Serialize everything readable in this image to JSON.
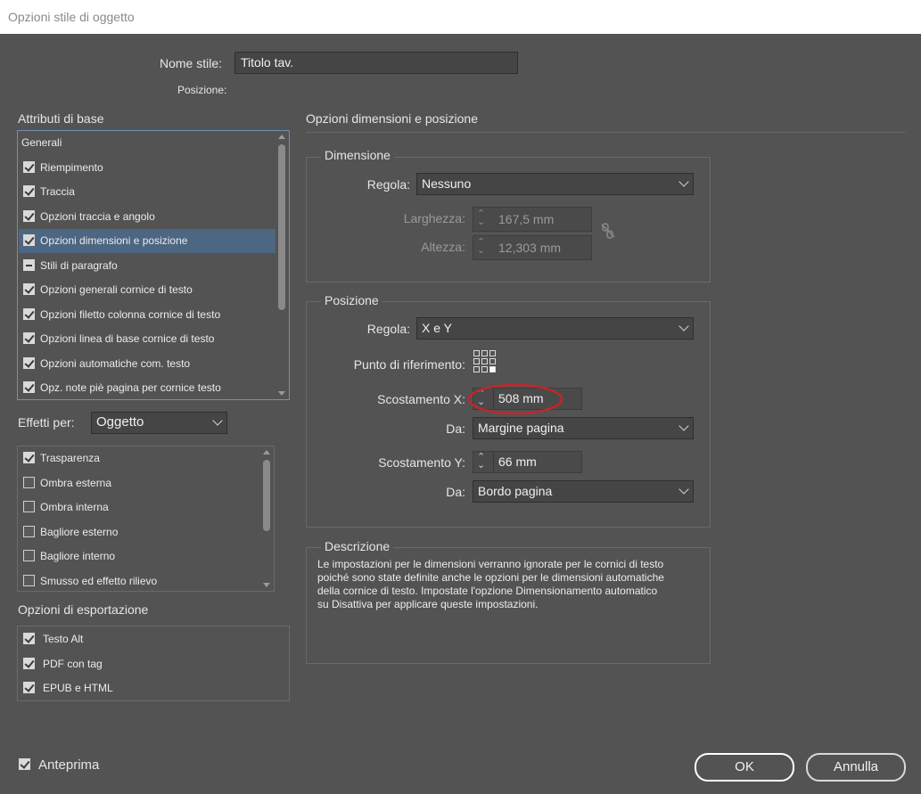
{
  "window": {
    "title": "Opzioni stile di oggetto"
  },
  "header": {
    "style_name_label": "Nome stile:",
    "style_name_value": "Titolo tav.",
    "position_label": "Posizione:"
  },
  "basic_attributes": {
    "heading": "Attributi di base",
    "items": [
      {
        "label": "Generali",
        "state": "none"
      },
      {
        "label": "Riempimento",
        "state": "checked"
      },
      {
        "label": "Traccia",
        "state": "checked"
      },
      {
        "label": "Opzioni traccia e angolo",
        "state": "checked"
      },
      {
        "label": "Opzioni dimensioni e posizione",
        "state": "checked"
      },
      {
        "label": "Stili di paragrafo",
        "state": "mixed"
      },
      {
        "label": "Opzioni generali cornice di testo",
        "state": "checked"
      },
      {
        "label": "Opzioni filetto colonna cornice di testo",
        "state": "checked"
      },
      {
        "label": "Opzioni linea di base cornice di testo",
        "state": "checked"
      },
      {
        "label": "Opzioni automatiche com. testo",
        "state": "checked"
      },
      {
        "label": "Opz. note piè pagina per cornice testo",
        "state": "checked"
      }
    ],
    "selected_index": 4
  },
  "effects": {
    "label": "Effetti per:",
    "value": "Oggetto",
    "items": [
      {
        "label": "Trasparenza",
        "checked": true
      },
      {
        "label": "Ombra esterna",
        "checked": false
      },
      {
        "label": "Ombra interna",
        "checked": false
      },
      {
        "label": "Bagliore esterno",
        "checked": false
      },
      {
        "label": "Bagliore interno",
        "checked": false
      },
      {
        "label": "Smusso ed effetto rilievo",
        "checked": false
      }
    ]
  },
  "export": {
    "heading": "Opzioni di esportazione",
    "items": [
      {
        "label": "Testo Alt",
        "checked": true
      },
      {
        "label": "PDF con tag",
        "checked": true
      },
      {
        "label": "EPUB e HTML",
        "checked": true
      }
    ]
  },
  "panel": {
    "title": "Opzioni dimensioni e posizione",
    "size": {
      "legend": "Dimensione",
      "rule_label": "Regola:",
      "rule_value": "Nessuno",
      "width_label": "Larghezza:",
      "width_value": "167,5 mm",
      "height_label": "Altezza:",
      "height_value": "12,303 mm"
    },
    "position": {
      "legend": "Posizione",
      "rule_label": "Regola:",
      "rule_value": "X e Y",
      "ref_point_label": "Punto di riferimento:",
      "offset_x_label": "Scostamento X:",
      "offset_x_value": "508 mm",
      "from_x_label": "Da:",
      "from_x_value": "Margine pagina",
      "offset_y_label": "Scostamento Y:",
      "offset_y_value": "66 mm",
      "from_y_label": "Da:",
      "from_y_value": "Bordo pagina"
    },
    "description": {
      "legend": "Descrizione",
      "lines": [
        "Le impostazioni per le dimensioni verranno ignorate per le cornici di testo",
        "poiché sono state definite anche le opzioni per le dimensioni automatiche",
        "della cornice di testo. Impostate l'opzione Dimensionamento automatico",
        "su Disattiva per applicare queste impostazioni."
      ]
    }
  },
  "footer": {
    "preview_label": "Anteprima",
    "preview_checked": true,
    "ok_label": "OK",
    "cancel_label": "Annulla"
  },
  "colors": {
    "dialog_bg": "#535353",
    "selection": "#4d6682",
    "highlight_circle": "#c0272d"
  }
}
